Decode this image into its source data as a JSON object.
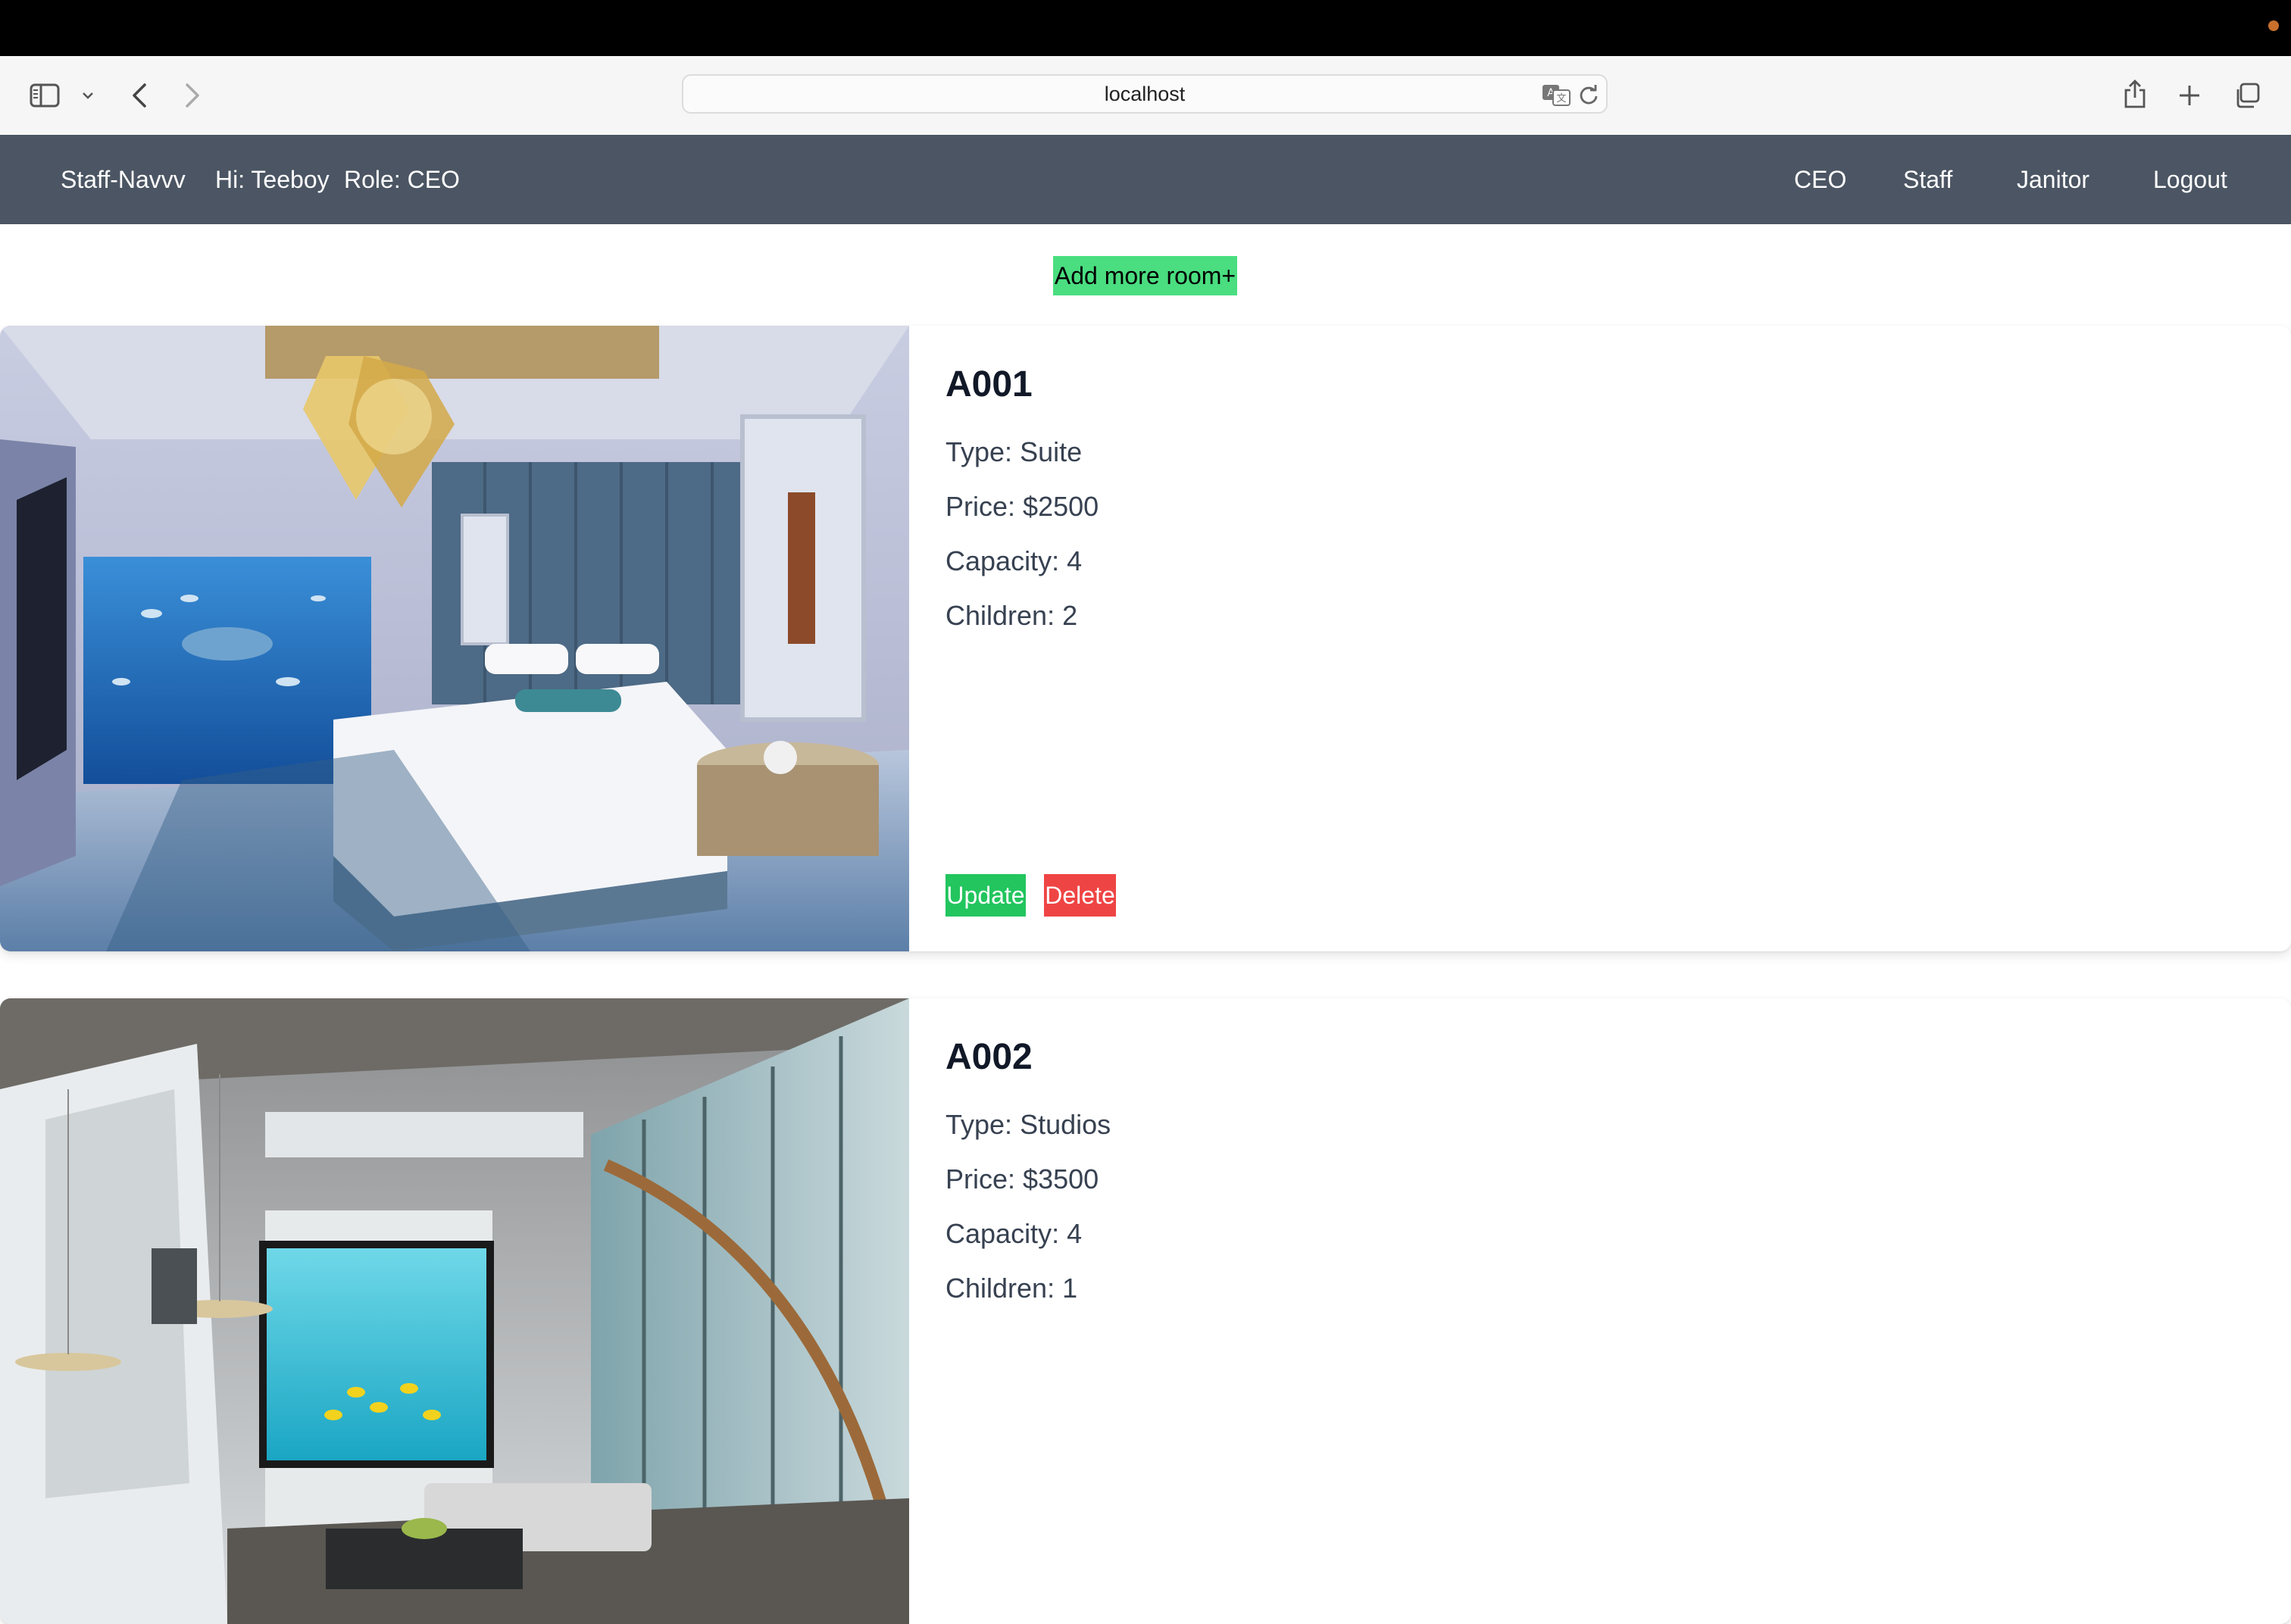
{
  "browser": {
    "url": "localhost"
  },
  "navbar": {
    "brand": "Staff-Navvv",
    "greeting": "Hi: Teeboy",
    "role": "Role: CEO",
    "links": [
      "CEO",
      "Staff",
      "Janitor",
      "Logout"
    ]
  },
  "add_room_label": "Add more room+",
  "rooms": [
    {
      "id": "A001",
      "type_label": "Type:",
      "type": "Suite",
      "price_label": "Price:",
      "price": "$2500",
      "capacity_label": "Capacity:",
      "capacity": "4",
      "children_label": "Children:",
      "children": "2",
      "update_label": "Update",
      "delete_label": "Delete"
    },
    {
      "id": "A002",
      "type_label": "Type:",
      "type": "Studios",
      "price_label": "Price:",
      "price": "$3500",
      "capacity_label": "Capacity:",
      "capacity": "4",
      "children_label": "Children:",
      "children": "1"
    }
  ],
  "colors": {
    "navbar_bg": "#4b5563",
    "add_button": "#4ade80",
    "update_button": "#22c55e",
    "delete_button": "#ef4444"
  },
  "icons": [
    "sidebar-icon",
    "chevron-down-icon",
    "back-icon",
    "forward-icon",
    "translate-icon",
    "reload-icon",
    "share-icon",
    "new-tab-icon",
    "tabs-overview-icon"
  ]
}
